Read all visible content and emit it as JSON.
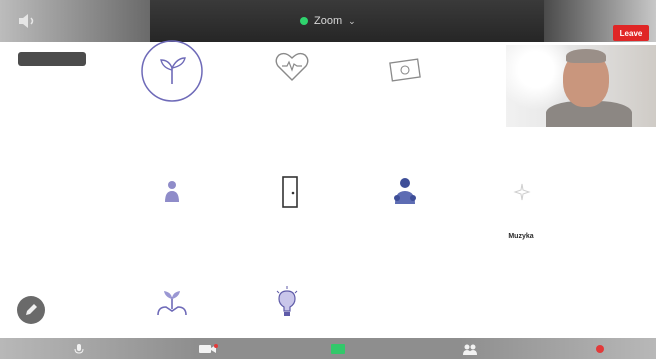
{
  "topbar": {
    "meeting_title": "Zoom",
    "leave_label": "Leave",
    "speaker_icon": "speaker-icon"
  },
  "view_pill": {
    "left": "",
    "right": ""
  },
  "grid": [
    {
      "icon": "sprout-icon",
      "caption": ""
    },
    {
      "icon": "heart-icon",
      "caption": ""
    },
    {
      "icon": "money-bill-icon",
      "caption": ""
    },
    {
      "icon": "person-icon",
      "caption": ""
    },
    {
      "icon": "door-icon",
      "caption": ""
    },
    {
      "icon": "group-icon",
      "caption": ""
    },
    {
      "icon": "sparkle-icon",
      "caption": "Muzyka"
    },
    {
      "icon": "plant-hands-icon",
      "caption": ""
    },
    {
      "icon": "lightbulb-icon",
      "caption": ""
    }
  ],
  "toolbar": {
    "mute_label": "",
    "share_label": "",
    "participants_count": ""
  },
  "colors": {
    "accent": "#2fd36d",
    "leave": "#e02626",
    "icon_purple": "#6e6ab8"
  }
}
